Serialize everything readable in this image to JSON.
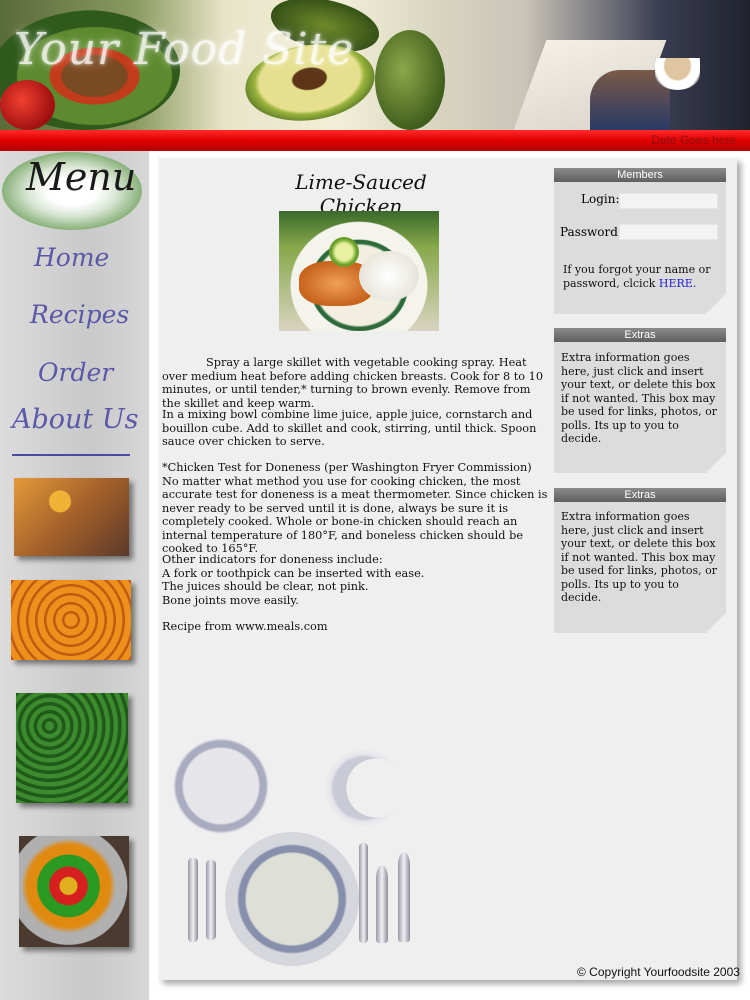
{
  "header": {
    "site_title": "Your Food Site",
    "red_bar_link": "Date Goes here"
  },
  "sidebar": {
    "menu_title": "Menu",
    "nav": [
      {
        "label": "Home"
      },
      {
        "label": "Recipes"
      },
      {
        "label": "Order"
      },
      {
        "label": "About Us"
      }
    ]
  },
  "main": {
    "recipe_title": "Lime-Sauced Chicken",
    "paragraphs": [
      "Spray a large skillet with vegetable cooking spray. Heat over medium heat before adding chicken breasts. Cook for 8 to 10 minutes, or until tender,* turning to brown evenly. Remove from the skillet and keep warm.",
      "In a mixing bowl combine lime juice, apple juice, cornstarch and bouillon cube. Add to skillet and cook, stirring, until thick. Spoon sauce over chicken to serve.",
      "*Chicken Test for Doneness (per Washington Fryer Commission)\nNo matter what method you use for cooking chicken, the most accurate test for doneness is a meat thermometer. Since chicken is never ready to be served until it is done, always be sure it is completely cooked. Whole or bone-in chicken should reach an internal temperature of 180°F, and boneless chicken should be cooked to 165°F.",
      "Other indicators for doneness include:\nA fork or toothpick can be inserted with ease.\nThe juices should be clear, not pink.\nBone joints move easily.",
      "Recipe from www.meals.com"
    ],
    "copyright": "© Copyright Yourfoodsite 2003"
  },
  "members": {
    "title": "Members",
    "login_label": "Login:",
    "password_label": "Password:",
    "login_value": "",
    "password_value": "",
    "forgot_text": "If you forgot your name or password, clcick ",
    "forgot_link": "HERE."
  },
  "extras": [
    {
      "title": "Extras",
      "text": "Extra information goes here, just click and insert your text, or delete this box if not wanted. This box may be used for links, photos, or polls.  Its up to you to decide."
    },
    {
      "title": "Extras",
      "text": "Extra information goes here, just click and insert your text, or delete this box if not wanted. This box may be used for links, photos, or polls.  Its up to you to decide."
    }
  ],
  "colors": {
    "red_bar": "#e00000",
    "nav_link": "#5a58a8",
    "box_header": "#6a6a6a",
    "main_panel": "#efefef",
    "sidebar": "#d0d0d0"
  }
}
